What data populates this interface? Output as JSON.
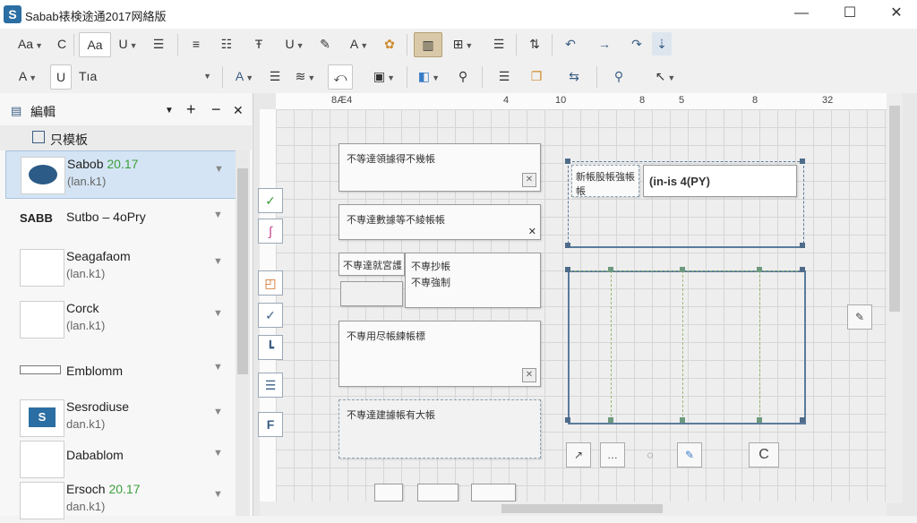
{
  "window": {
    "title": "Sabab裱検途通2017网絡版",
    "logo": "S",
    "minimize": "—",
    "maximize": "☐",
    "close": "✕"
  },
  "toolbar1": {
    "font_size_label": "Aa",
    "clear_label": "C",
    "style_box": "Aa",
    "bold_dropdown": "U",
    "tab_active": "⾊",
    "icons": [
      "text-align-icon",
      "list-icon",
      "indent-icon",
      "underline-icon",
      "image-edit-icon",
      "font-color-icon",
      "palette-icon",
      "column-layout-icon",
      "table-icon",
      "numbered-list-icon",
      "sort-icon",
      "undo-icon",
      "forward-icon",
      "redo-icon",
      "pin-icon"
    ]
  },
  "toolbar2": {
    "font_label": "A",
    "underline_label": "U",
    "style_name": "Tıa",
    "icons": [
      "font-color-icon",
      "align-icon",
      "kerning-icon",
      "spacing-icon",
      "frame-icon",
      "shape-icon",
      "search-person-icon",
      "list-icon",
      "copy-icon",
      "rotate-icon",
      "zoom-icon",
      "cursor-icon"
    ]
  },
  "panel": {
    "title": "編輯",
    "subtitle": "只模板",
    "add": "+",
    "remove": "−",
    "close": "✕",
    "items": [
      {
        "name": "Sabob",
        "version": "20.17",
        "sub": "(lan.k1)",
        "thumb": "sabob-logo-icon"
      },
      {
        "name": "Sutbo – 4oPry",
        "version": "",
        "sub": "",
        "thumb": "sabb-logo-icon",
        "thumb_text": "SABB"
      },
      {
        "name": "Seagafaom",
        "version": "",
        "sub": "(lan.k1)",
        "thumb": "form-template-icon"
      },
      {
        "name": "Corck",
        "version": "",
        "sub": "(lan.k1)",
        "thumb": "window-template-icon"
      },
      {
        "name": "Emblomm",
        "version": "",
        "sub": "",
        "thumb": "arrow-shape-icon"
      },
      {
        "name": "Sesrodiuse",
        "version": "",
        "sub": "dan.k1)",
        "thumb": "sabob-logo-small-icon"
      },
      {
        "name": "Dabablom",
        "version": "",
        "sub": "",
        "thumb": "node-diagram-icon"
      },
      {
        "name": "Ersoch",
        "version": "20.17",
        "sub": "dan.k1)",
        "thumb": "node-diagram-icon-2"
      }
    ]
  },
  "ruler": {
    "ticks": [
      "8Æ4",
      "4",
      "10",
      "8",
      "5",
      "8",
      "32"
    ]
  },
  "canvas": {
    "cards": [
      {
        "text": "不等達領據得不幾帳"
      },
      {
        "text": "不専達數據等不綾帳帳"
      },
      {
        "text": "不専達就宮護"
      },
      {
        "text": "不専抄帳"
      },
      {
        "text": "不専強制"
      },
      {
        "text": "不専用尽帳練帳標"
      },
      {
        "text": "不専達建據帳有大帳"
      },
      {
        "text": "新帳股帳強帳帳"
      }
    ],
    "field_value": "(in-is 4(PY)",
    "bottom_buttons": [
      "↗",
      "…",
      "◌",
      "✎",
      "C"
    ]
  }
}
